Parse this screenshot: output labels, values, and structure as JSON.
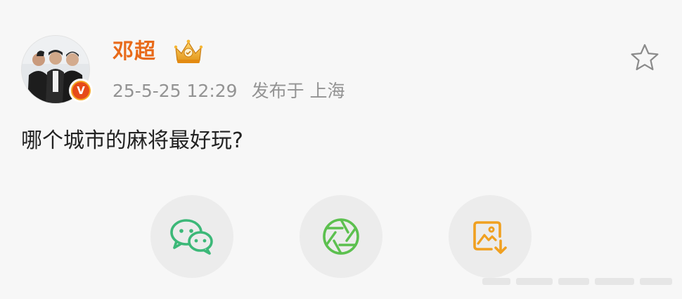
{
  "post": {
    "author": {
      "name": "邓超",
      "verified_badge_letter": "V",
      "rank_icon": "crown-badge-icon",
      "avatar_description": "group-photo-avatar"
    },
    "time": "25-5-25 12:29",
    "location": "发布于 上海",
    "text": "哪个城市的麻将最好玩?"
  },
  "actions": {
    "favorite_icon": "star-icon"
  },
  "share": [
    {
      "name": "wechat",
      "icon": "wechat-icon",
      "color": "#3cb878"
    },
    {
      "name": "moments",
      "icon": "moments-aperture-icon",
      "color": "#5cc04f"
    },
    {
      "name": "save-image",
      "icon": "save-image-icon",
      "color": "#f0a020"
    }
  ],
  "colors": {
    "username": "#e86a1a",
    "meta_text": "#939393",
    "body_text": "#222222",
    "background": "#f7f7f7"
  }
}
